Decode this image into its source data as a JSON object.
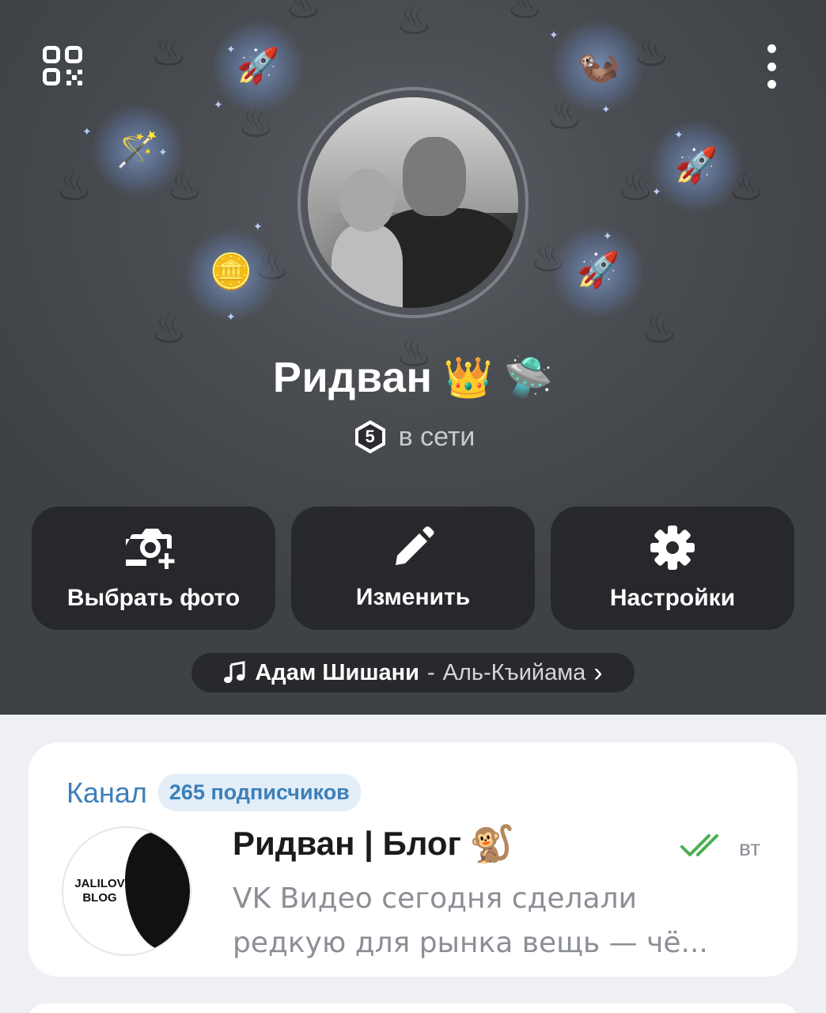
{
  "header": {
    "qr_icon": "qr-code-icon",
    "menu_icon": "more-vertical-icon",
    "profile_name": "Ридван",
    "name_emojis": [
      "👑",
      "🛸"
    ],
    "level": "5",
    "status": "в сети",
    "gifts": [
      "🚀",
      "🦦",
      "🪄",
      "🚀",
      "🪙",
      "🚀"
    ]
  },
  "actions": [
    {
      "label": "Выбрать фото",
      "icon": "add-photo-icon"
    },
    {
      "label": "Изменить",
      "icon": "pencil-icon"
    },
    {
      "label": "Настройки",
      "icon": "gear-icon"
    }
  ],
  "music": {
    "artist": "Адам Шишани",
    "separator": "-",
    "track": "Аль-Къийама",
    "chevron": "›"
  },
  "channel": {
    "label": "Канал",
    "subscribers": "265 подписчиков",
    "avatar_text": "JALILOV BLOG",
    "title": "Ридван | Блог",
    "title_emoji": "🐒",
    "day": "вт",
    "preview": "VK Видео сегодня сделали редкую для рынка вещь — чё..."
  },
  "colors": {
    "accent": "#3c7fb8",
    "read_check": "#4caf50",
    "header_bg": "#4a4d52"
  }
}
